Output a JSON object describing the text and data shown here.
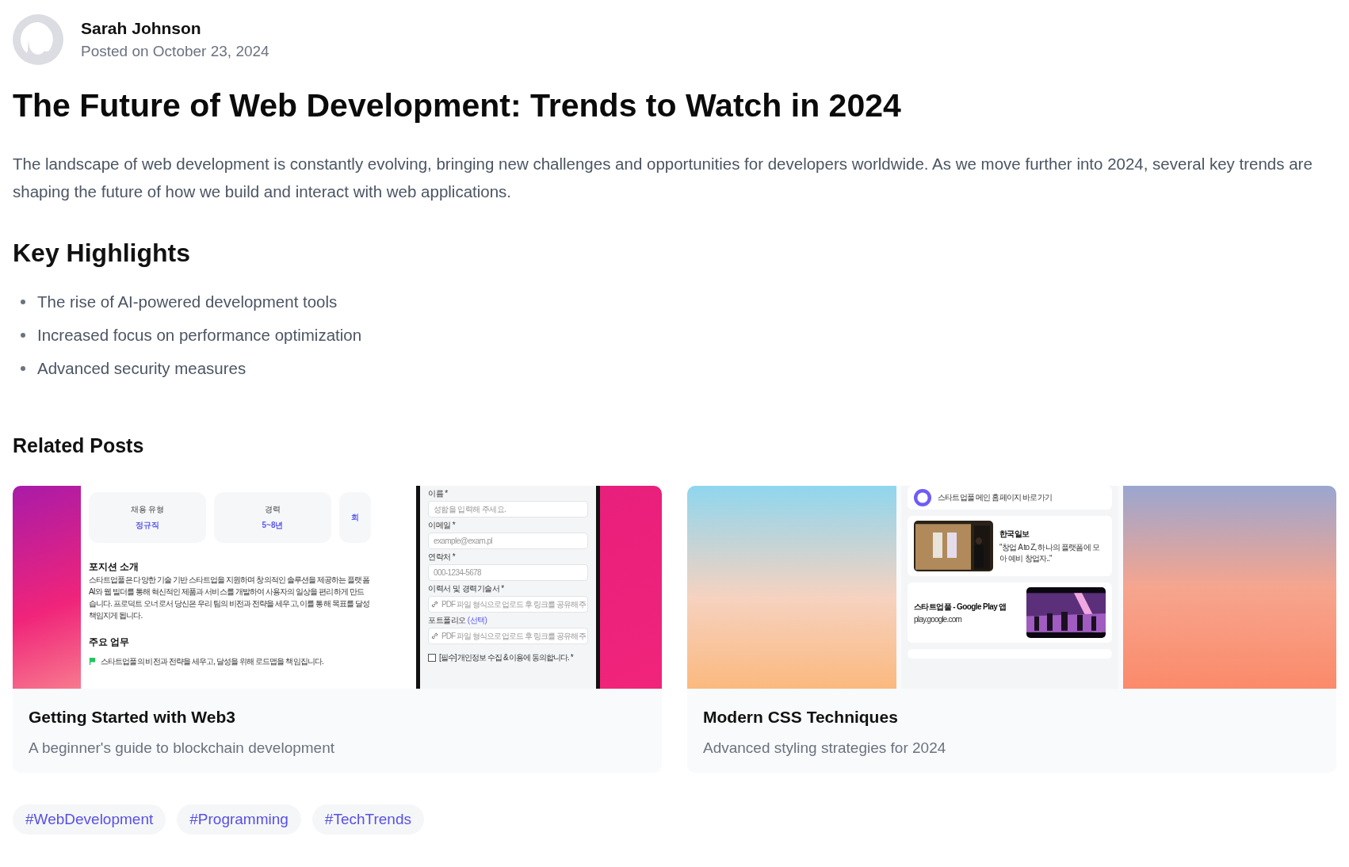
{
  "author": {
    "name": "Sarah Johnson",
    "posted": "Posted on October 23, 2024"
  },
  "title": "The Future of Web Development: Trends to Watch in 2024",
  "intro": "The landscape of web development is constantly evolving, bringing new challenges and opportunities for developers worldwide. As we move further into 2024, several key trends are shaping the future of how we build and interact with web applications.",
  "highlights": {
    "heading": "Key Highlights",
    "items": [
      "The rise of AI-powered development tools",
      "Increased focus on performance optimization",
      "Advanced security measures"
    ]
  },
  "related": {
    "heading": "Related Posts",
    "posts": [
      {
        "title": "Getting Started with Web3",
        "description": "A beginner's guide to blockchain development",
        "thumbnail": {
          "kind": "job_posting",
          "stats": [
            {
              "label": "채용 유형",
              "value": "정규직"
            },
            {
              "label": "경력",
              "value": "5~8년"
            },
            {
              "value": "회"
            }
          ],
          "section_heading": "포지션 소개",
          "paragraph_lines": [
            "스타트업풀은 다양한 기술 기반 스타트업을 지원하며 창의적인 솔루션을 제공하는 플랫폼",
            "AI와 웹 빌더를 통해 혁신적인 제품과 서비스를 개발하여 사용자의 일상을 편리하게 만드",
            "습니다. 프로덕트 오너로서 당신은 우리 팀의 비전과 전략을 세우고, 이를 통해 목표를 달성",
            "책임지게 됩니다."
          ],
          "duties_heading": "주요 업무",
          "duties": [
            "스타트업풀의 비전과 전략을 세우고, 달성을 위해 로드맵을 책임집니다."
          ],
          "form": {
            "fields": [
              {
                "kind": "text",
                "label": "이름 *",
                "placeholder": "성함을 입력해 주세요."
              },
              {
                "kind": "text",
                "label": "이메일 *",
                "placeholder": "example@exam.pl"
              },
              {
                "kind": "text",
                "label": "연락처 *",
                "placeholder": "000-1234-5678"
              },
              {
                "kind": "link",
                "label": "이력서 및 경력기술서 *",
                "placeholder": "PDF 파일 형식으로 업로드 후 링크를 공유해 주"
              },
              {
                "kind": "link",
                "label": "포트폴리오",
                "note": "(선택)",
                "placeholder": "PDF 파일 형식으로 업로드 후 링크를 공유해 주"
              }
            ],
            "consent": {
              "label": "[필수] 개인정보 수집 & 이용에 동의합니다. *",
              "checked": false
            }
          }
        }
      },
      {
        "title": "Modern CSS Techniques",
        "description": "Advanced styling strategies for 2024",
        "thumbnail": {
          "kind": "link_list",
          "links": [
            {
              "kind": "logo",
              "text": "스타트업풀 메인 홈페이지 바로가기"
            },
            {
              "kind": "article",
              "title": "한국일보",
              "text": "\"창업 A to Z, 하나의 플랫폼에 모아 예비 창업자..\""
            },
            {
              "kind": "app",
              "title": "스타트업풀 - Google Play 앱",
              "text": "play.google.com"
            }
          ]
        }
      }
    ]
  },
  "tags": [
    "#WebDevelopment",
    "#Programming",
    "#TechTrends"
  ]
}
